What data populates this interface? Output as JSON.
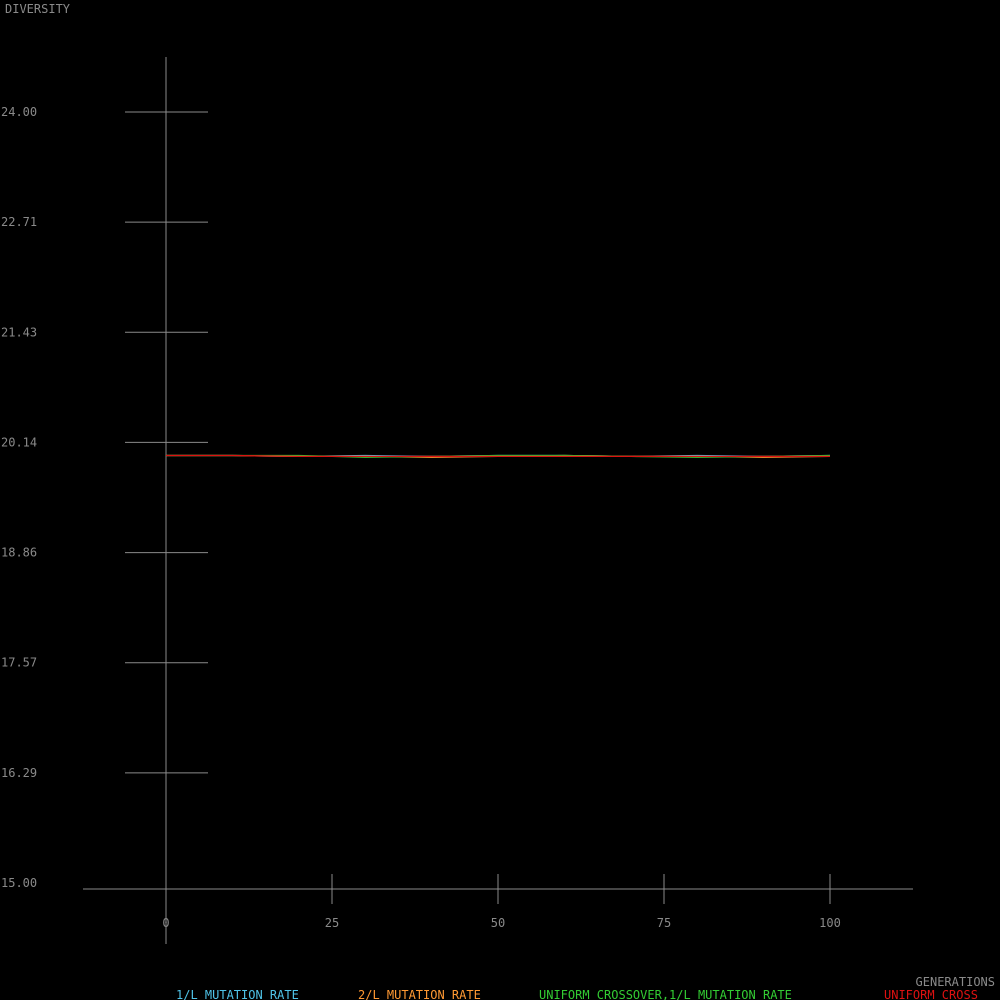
{
  "chart_data": {
    "type": "line",
    "ylabel": "DIVERSITY",
    "xlabel": "GENERATIONS",
    "xlim": [
      0,
      100
    ],
    "ylim": [
      15.0,
      24.0
    ],
    "x_ticks": [
      "0",
      "25",
      "50",
      "75",
      "100"
    ],
    "y_ticks": [
      "24.00",
      "22.71",
      "21.43",
      "20.14",
      "18.86",
      "17.57",
      "16.29",
      "15.00"
    ],
    "grid": false,
    "legend_position": "bottom",
    "series": [
      {
        "name": "1/L MUTATION RATE",
        "color": "#4fc3e8",
        "x": [
          0,
          10,
          20,
          30,
          40,
          50,
          60,
          70,
          80,
          90,
          100
        ],
        "y": [
          19.99,
          19.99,
          19.98,
          19.99,
          19.98,
          19.99,
          19.99,
          19.98,
          19.99,
          19.98,
          19.99
        ]
      },
      {
        "name": "2/L MUTATION RATE",
        "color": "#ff9933",
        "x": [
          0,
          10,
          20,
          30,
          40,
          50,
          60,
          70,
          80,
          90,
          100
        ],
        "y": [
          19.99,
          19.99,
          19.98,
          19.98,
          19.97,
          19.98,
          19.99,
          19.98,
          19.98,
          19.97,
          19.98
        ]
      },
      {
        "name": "UNIFORM CROSSOVER,1/L MUTATION RATE",
        "color": "#33cc33",
        "x": [
          0,
          10,
          20,
          30,
          40,
          50,
          60,
          70,
          80,
          90,
          100
        ],
        "y": [
          19.99,
          19.99,
          19.99,
          19.97,
          19.98,
          19.99,
          19.99,
          19.98,
          19.97,
          19.98,
          19.99
        ]
      },
      {
        "name": "UNIFORM CROSS",
        "color": "#dd1111",
        "x": [
          0,
          10,
          20,
          30,
          40,
          50,
          60,
          70,
          80,
          90,
          100
        ],
        "y": [
          19.99,
          19.99,
          19.98,
          19.98,
          19.98,
          19.98,
          19.98,
          19.98,
          19.98,
          19.98,
          19.98
        ]
      }
    ]
  }
}
